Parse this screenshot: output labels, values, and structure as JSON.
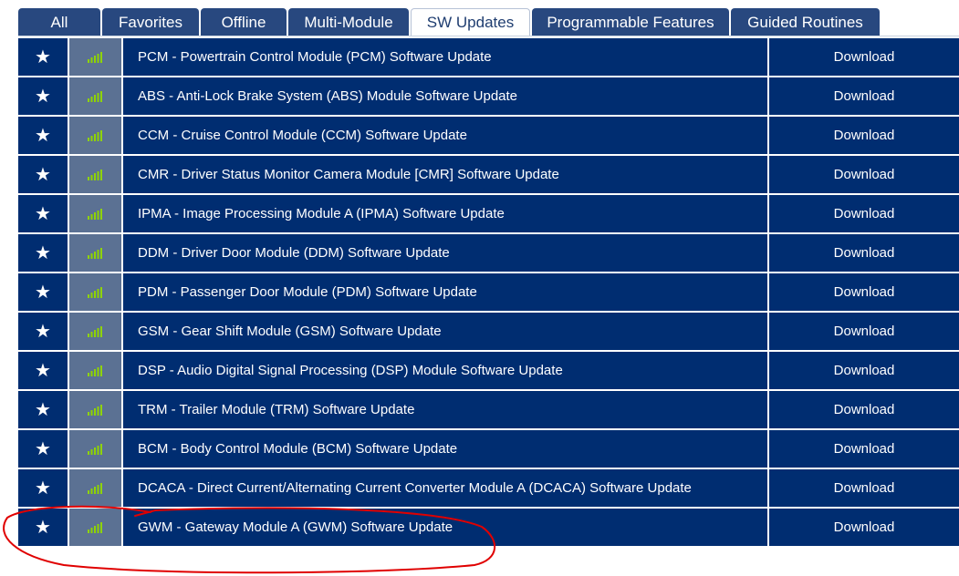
{
  "tabs": [
    {
      "label": "All",
      "active": false
    },
    {
      "label": "Favorites",
      "active": false
    },
    {
      "label": "Offline",
      "active": false
    },
    {
      "label": "Multi-Module",
      "active": false
    },
    {
      "label": "SW Updates",
      "active": true
    },
    {
      "label": "Programmable Features",
      "active": false
    },
    {
      "label": "Guided Routines",
      "active": false
    }
  ],
  "rows": [
    {
      "name": "PCM - Powertrain Control Module (PCM) Software Update",
      "action": "Download"
    },
    {
      "name": "ABS - Anti-Lock Brake System (ABS) Module Software Update",
      "action": "Download"
    },
    {
      "name": "CCM - Cruise Control Module (CCM) Software Update",
      "action": "Download"
    },
    {
      "name": "CMR - Driver Status Monitor Camera Module [CMR] Software Update",
      "action": "Download"
    },
    {
      "name": "IPMA - Image Processing Module A (IPMA) Software Update",
      "action": "Download"
    },
    {
      "name": "DDM - Driver Door Module (DDM) Software Update",
      "action": "Download"
    },
    {
      "name": "PDM - Passenger Door Module (PDM) Software Update",
      "action": "Download"
    },
    {
      "name": "GSM - Gear Shift Module (GSM) Software Update",
      "action": "Download"
    },
    {
      "name": "DSP - Audio Digital Signal Processing (DSP) Module Software Update",
      "action": "Download"
    },
    {
      "name": "TRM - Trailer Module (TRM) Software Update",
      "action": "Download"
    },
    {
      "name": "BCM - Body Control Module (BCM) Software Update",
      "action": "Download"
    },
    {
      "name": "DCACA - Direct Current/Alternating Current Converter Module A (DCACA) Software Update",
      "action": "Download"
    },
    {
      "name": "GWM - Gateway Module A (GWM) Software Update",
      "action": "Download"
    }
  ],
  "icons": {
    "favorite": "star-icon",
    "signal": "signal-bars-icon"
  },
  "colors": {
    "tab_bg": "#28487f",
    "row_bg": "#002d71",
    "signal_cell_bg": "#5b7193",
    "signal_bars": "#8fd400",
    "annotation": "#e00000"
  }
}
